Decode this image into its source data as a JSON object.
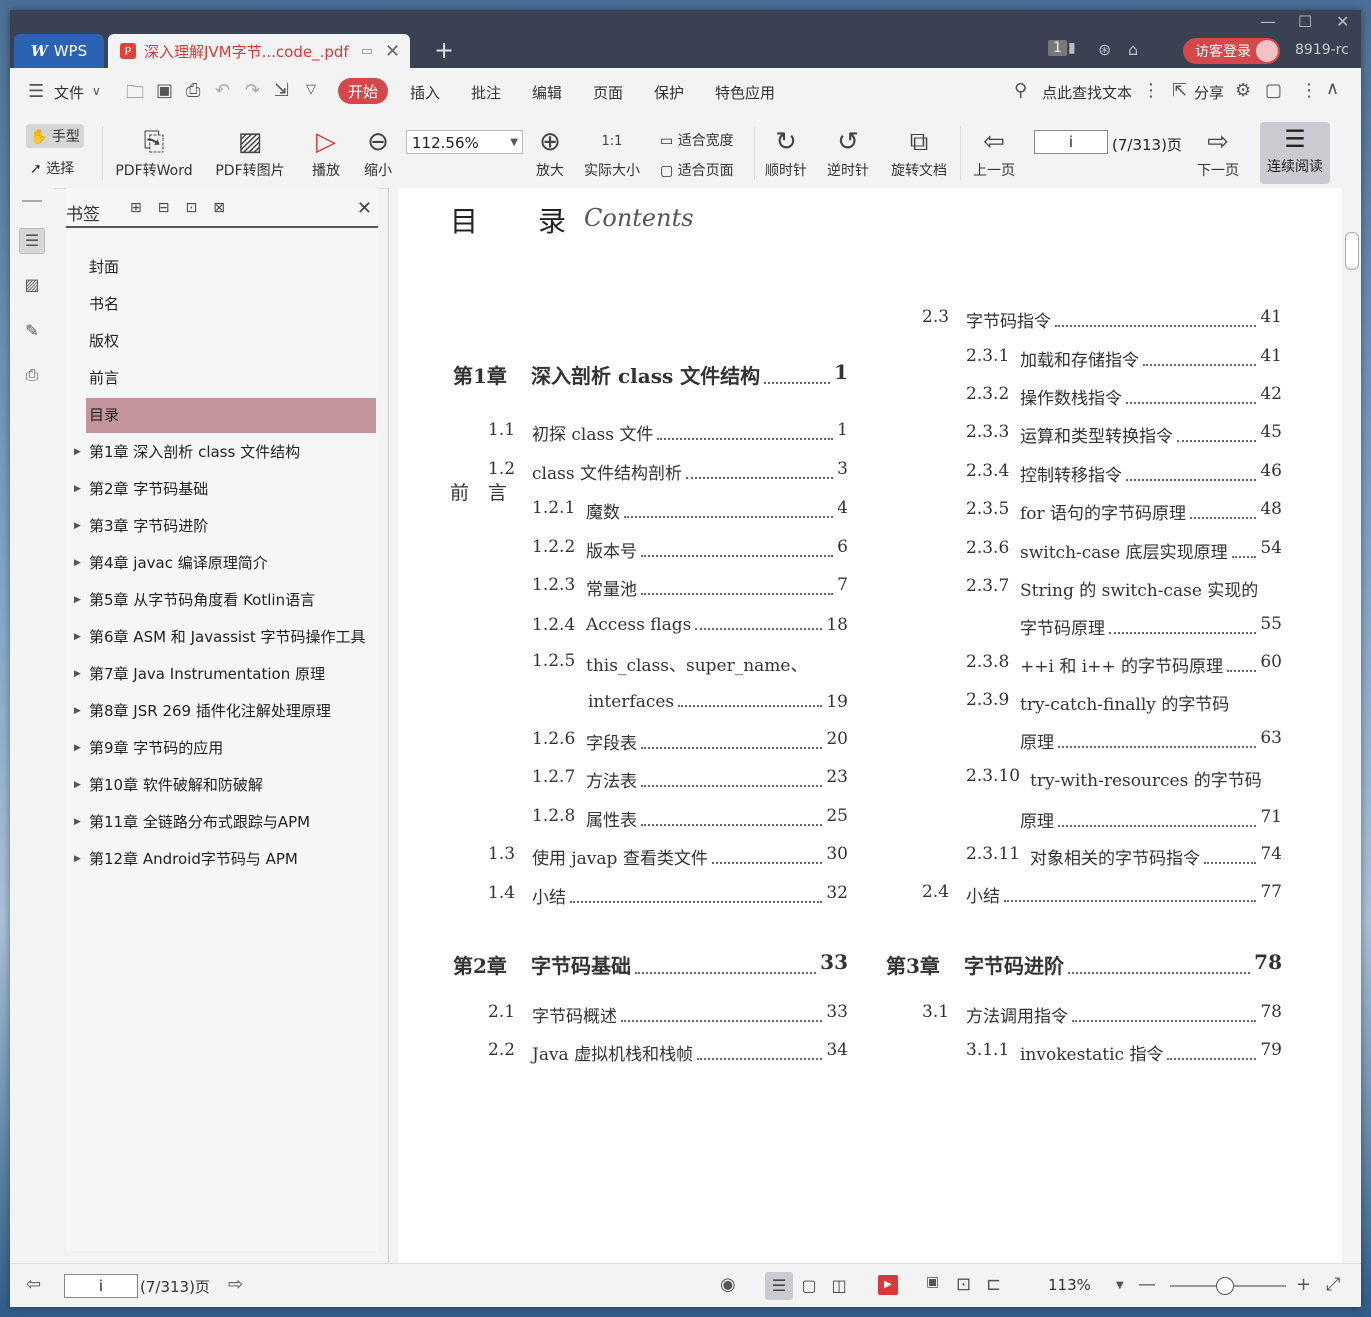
{
  "titlebar": {
    "app_tab": "WPS",
    "doc_tab": "深入理解JVM字节...code_.pdf",
    "login": "访客登录",
    "user_id": "8919-rc",
    "badge": "1"
  },
  "menubar": {
    "file": "文件",
    "items": [
      "开始",
      "插入",
      "批注",
      "编辑",
      "页面",
      "保护",
      "特色应用"
    ],
    "search": "点此查找文本",
    "share": "分享"
  },
  "toolbar": {
    "hand": "手型",
    "select": "选择",
    "pdf2word": "PDF转Word",
    "pdf2img": "PDF转图片",
    "play": "播放",
    "zoom_out": "缩小",
    "zoom_value": "112.56%",
    "zoom_in": "放大",
    "actual_size": "实际大小",
    "fit_width": "适合宽度",
    "fit_page": "适合页面",
    "clockwise": "顺时针",
    "counterclockwise": "逆时针",
    "rotate_doc": "旋转文档",
    "prev_page": "上一页",
    "page_input": "i",
    "page_count": "(7/313)页",
    "next_page": "下一页",
    "continuous": "连续阅读",
    "actual_icon": "1:1"
  },
  "bookmarks": {
    "title": "书签",
    "items": [
      {
        "label": "封面",
        "expandable": false
      },
      {
        "label": "书名",
        "expandable": false
      },
      {
        "label": "版权",
        "expandable": false
      },
      {
        "label": "前言",
        "expandable": false
      },
      {
        "label": "目录",
        "expandable": false,
        "selected": true
      },
      {
        "label": "第1章 深入剖析 class 文件结构",
        "expandable": true
      },
      {
        "label": "第2章 字节码基础",
        "expandable": true
      },
      {
        "label": "第3章 字节码进阶",
        "expandable": true
      },
      {
        "label": "第4章 javac 编译原理简介",
        "expandable": true
      },
      {
        "label": "第5章 从字节码角度看 Kotlin语言",
        "expandable": true
      },
      {
        "label": "第6章 ASM 和 Javassist 字节码操作工具",
        "expandable": true
      },
      {
        "label": "第7章 Java Instrumentation 原理",
        "expandable": true
      },
      {
        "label": "第8章 JSR 269 插件化注解处理原理",
        "expandable": true
      },
      {
        "label": "第9章 字节码的应用",
        "expandable": true
      },
      {
        "label": "第10章 软件破解和防破解",
        "expandable": true
      },
      {
        "label": "第11章 全链路分布式跟踪与APM",
        "expandable": true
      },
      {
        "label": "第12章 Android字节码与 APM",
        "expandable": true
      }
    ]
  },
  "page": {
    "title_a": "目",
    "title_b": "录",
    "contents": "Contents",
    "preface": "前　言",
    "left": [
      {
        "num": "第1章",
        "text": "深入剖析 class 文件结构",
        "pg": "1",
        "level": 0
      },
      {
        "num": "1.1",
        "text": "初探 class 文件",
        "pg": "1",
        "level": 1
      },
      {
        "num": "1.2",
        "text": "class 文件结构剖析",
        "pg": "3",
        "level": 1
      },
      {
        "num": "1.2.1",
        "text": "魔数",
        "pg": "4",
        "level": 2
      },
      {
        "num": "1.2.2",
        "text": "版本号",
        "pg": "6",
        "level": 2
      },
      {
        "num": "1.2.3",
        "text": "常量池",
        "pg": "7",
        "level": 2
      },
      {
        "num": "1.2.4",
        "text": "Access flags",
        "pg": "18",
        "level": 2
      },
      {
        "num": "1.2.5",
        "text": "this_class、super_name、",
        "pg": "",
        "level": 2
      },
      {
        "num": "",
        "text": "interfaces",
        "pg": "19",
        "level": 3
      },
      {
        "num": "1.2.6",
        "text": "字段表",
        "pg": "20",
        "level": 2
      },
      {
        "num": "1.2.7",
        "text": "方法表",
        "pg": "23",
        "level": 2
      },
      {
        "num": "1.2.8",
        "text": "属性表",
        "pg": "25",
        "level": 2
      },
      {
        "num": "1.3",
        "text": "使用 javap 查看类文件",
        "pg": "30",
        "level": 1
      },
      {
        "num": "1.4",
        "text": "小结",
        "pg": "32",
        "level": 1
      },
      {
        "num": "第2章",
        "text": "字节码基础",
        "pg": "33",
        "level": 0
      },
      {
        "num": "2.1",
        "text": "字节码概述",
        "pg": "33",
        "level": 1
      },
      {
        "num": "2.2",
        "text": "Java 虚拟机栈和栈帧",
        "pg": "34",
        "level": 1
      }
    ],
    "right": [
      {
        "num": "2.3",
        "text": "字节码指令",
        "pg": "41",
        "level": 1
      },
      {
        "num": "2.3.1",
        "text": "加载和存储指令",
        "pg": "41",
        "level": 2
      },
      {
        "num": "2.3.2",
        "text": "操作数栈指令",
        "pg": "42",
        "level": 2
      },
      {
        "num": "2.3.3",
        "text": "运算和类型转换指令",
        "pg": "45",
        "level": 2
      },
      {
        "num": "2.3.4",
        "text": "控制转移指令",
        "pg": "46",
        "level": 2
      },
      {
        "num": "2.3.5",
        "text": "for 语句的字节码原理",
        "pg": "48",
        "level": 2
      },
      {
        "num": "2.3.6",
        "text": "switch-case 底层实现原理",
        "pg": "54",
        "level": 2
      },
      {
        "num": "2.3.7",
        "text": "String 的 switch-case 实现的",
        "pg": "",
        "level": 2
      },
      {
        "num": "",
        "text": "字节码原理",
        "pg": "55",
        "level": 3
      },
      {
        "num": "2.3.8",
        "text": "++i 和 i++ 的字节码原理",
        "pg": "60",
        "level": 2
      },
      {
        "num": "2.3.9",
        "text": "try-catch-finally 的字节码",
        "pg": "",
        "level": 2
      },
      {
        "num": "",
        "text": "原理",
        "pg": "63",
        "level": 3
      },
      {
        "num": "2.3.10",
        "text": "try-with-resources 的字节码",
        "pg": "",
        "level": 2
      },
      {
        "num": "",
        "text": "原理",
        "pg": "71",
        "level": 3
      },
      {
        "num": "2.3.11",
        "text": "对象相关的字节码指令",
        "pg": "74",
        "level": 2
      },
      {
        "num": "2.4",
        "text": "小结",
        "pg": "77",
        "level": 1
      },
      {
        "num": "第3章",
        "text": "字节码进阶",
        "pg": "78",
        "level": 0
      },
      {
        "num": "3.1",
        "text": "方法调用指令",
        "pg": "78",
        "level": 1
      },
      {
        "num": "3.1.1",
        "text": "invokestatic 指令",
        "pg": "79",
        "level": 2
      }
    ]
  },
  "status": {
    "page_input": "i",
    "page_count": "(7/313)页",
    "zoom": "113%"
  },
  "colors": {
    "accent_red": "#d4474a",
    "selected_bookmark": "#c2949b",
    "titlebar": "#3a4152"
  }
}
